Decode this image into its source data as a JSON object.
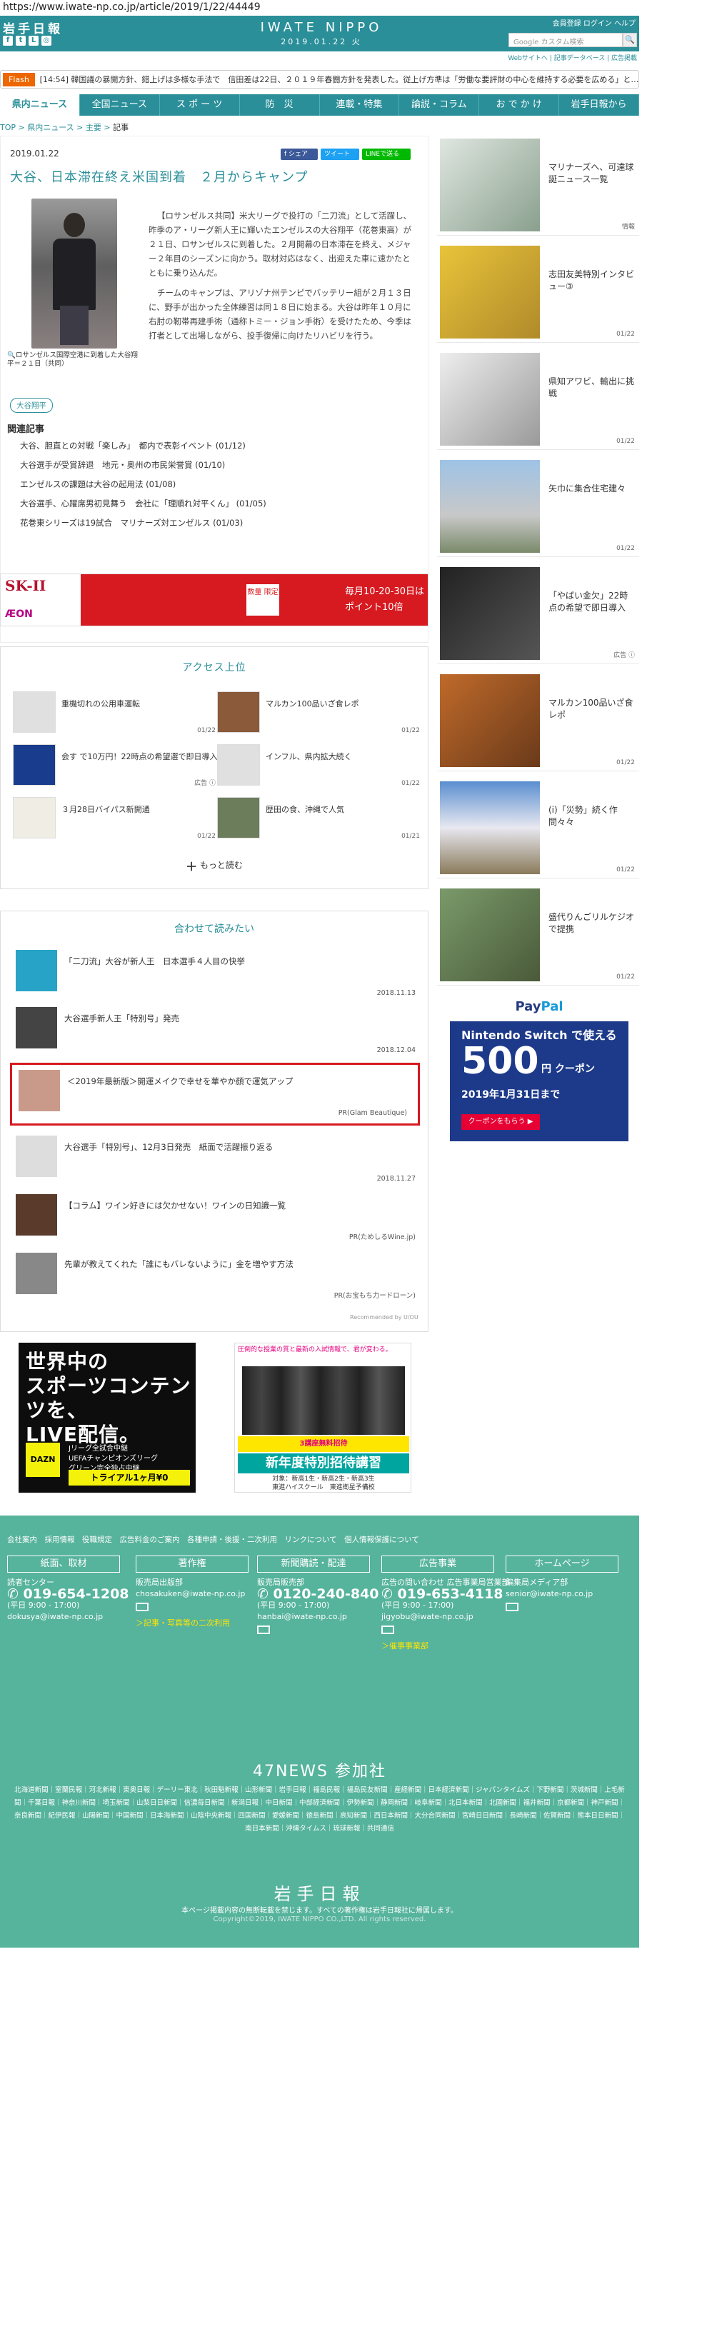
{
  "url": "https://www.iwate-np.co.jp/article/2019/1/22/44449",
  "header": {
    "logo_small": "岩手日報",
    "brand": "IWATE NIPPO",
    "date": "2019.01.22 火",
    "top_links": "会員登録  ログイン  ヘルプ",
    "search_placeholder": "Google カスタム検索",
    "search_button": "🔍",
    "sublinks": "Webサイトへ  |  記事データベース  |  広告掲載"
  },
  "ticker": {
    "badge": "Flash",
    "text": "[14:54] 韓国議の暴開方針、錯上げは多様な手法で　信田差は22日、２０１９年春闘方針を発表した。従上げ方準は「労働な要評財の中心を維持する必要を広める」と…"
  },
  "nav": [
    "県内ニュース",
    "全国ニュース",
    "ス ポ ー ツ",
    "防　災",
    "連載・特集",
    "論説・コラム",
    "お で か け",
    "岩手日報から"
  ],
  "breadcrumb": {
    "top": "TOP",
    "sep1": " > ",
    "l1": "県内ニュース",
    "sep2": " > ",
    "l2": "主要",
    "sep3": " > ",
    "current": "記事"
  },
  "article": {
    "date": "2019.01.22",
    "share_fb": "f シェア",
    "share_tw": "ツイート",
    "share_line": "LINEで送る",
    "title": "大谷、日本滞在終え米国到着　２月からキャンプ",
    "caption": "ロサンゼルス国際空港に到着した大谷翔平＝２１日（共同）",
    "paragraphs": [
      "【ロサンゼルス共同】米大リーグで投打の「二刀流」として活躍し、昨季のア・リーグ新人王に輝いたエンゼルスの大谷翔平（花巻東高）が２１日、ロサンゼルスに到着した。２月開幕の日本滞在を終え、メジャー２年目のシーズンに向かう。取材対応はなく、出迎えた車に速かたとともに乗り込んだ。",
      "チームのキャンプは、アリゾナ州テンピでバッテリー組が２月１３日に、野手が出かった全体練習は同１８日に始まる。大谷は昨年１０月に右肘の靭帯再建手術（通称トミー・ジョン手術）を受けたため、今季は打者として出場しながら、投手復帰に向けたリハビリを行う。"
    ],
    "tag": "大谷翔平",
    "related_heading": "関連記事",
    "related": [
      "大谷、胆直との対戦「楽しみ」　都内で表彰イベント (01/12)",
      "大谷選手が受賞辞退　地元・奥州の市民栄誉賞 (01/10)",
      "エンゼルスの課題は大谷の起用法 (01/08)",
      "大谷選手、心躍席男初見舞う　会社に「理順れ対平くん」 (01/05)",
      "花巻東シリーズは19試合　マリナーズ対エンゼルス (01/03)"
    ]
  },
  "ad_banner": {
    "brand1": "SK-II",
    "brand2": "ÆON",
    "box": "数量 限定",
    "text1": "毎月10-20-30日は",
    "text2": "ポイント10倍"
  },
  "ranking": {
    "title": "アクセス上位",
    "items": [
      {
        "text": "重機切れの公用車運転",
        "date": "01/22"
      },
      {
        "text": "マルカン100品いざ食レポ",
        "date": "01/22"
      },
      {
        "text": "会す で10万円！22時点の希望選で即日導入",
        "date": "広告 ⓘ"
      },
      {
        "text": "インフル、県内拡大続く",
        "date": "01/22"
      },
      {
        "text": "３月28日バイパス新開通",
        "date": "01/22"
      },
      {
        "text": "歴田の食、沖縄で人気",
        "date": "01/21"
      }
    ],
    "more": "もっと読む"
  },
  "also": {
    "title": "合わせて読みたい",
    "items": [
      {
        "text": "「二刀流」大谷が新人王　日本選手４人目の快挙",
        "meta": "2018.11.13"
      },
      {
        "text": "大谷選手新人王「特別号」発売",
        "meta": "2018.12.04"
      },
      {
        "text": "＜2019年最新版＞開運メイクで幸せを華やか顔で運気アップ",
        "meta": "PR(Glam Beautique)"
      },
      {
        "text": "大谷選手「特別号」、12月3日発売　紙面で活躍振り返る",
        "meta": "2018.11.27"
      },
      {
        "text": "【コラム】ワイン好きには欠かせない！ワインの日知識一覧",
        "meta": "PR(ためしるWine.jp)"
      },
      {
        "text": "先輩が教えてくれた「誰にもバレないように」金を増やす方法",
        "meta": "PR(お宝もち力ードローン)"
      }
    ],
    "recommended": "Recommended by U/OU"
  },
  "ad_dazn": {
    "headline": "世界中の\nスポーツコンテンツを、\nLIVE配信。",
    "logo": "DAZN",
    "sub": "Jリーグ全試合中継\nUEFAチャンピオンズリーグ\nグリーン完全独占中継",
    "btn": "トライアル1ヶ月¥0"
  },
  "ad_school": {
    "top": "圧倒的な授業の質と最新の入試情報で、君が変わる。",
    "mid": "3講座無料招待",
    "big": "新年度特別招待講習",
    "bot": "対象：新高1生・新高2生・新高3生\n東進ハイスクール　東進衛星予備校"
  },
  "sidebar": [
    {
      "text": "マリナーズへ、可達球誕ニュース一覧",
      "date": "情報"
    },
    {
      "text": "志田友美特別インタビュー③",
      "date": "01/22"
    },
    {
      "text": "県知アワビ、輸出に挑戦",
      "date": "01/22"
    },
    {
      "text": "矢巾に集合住宅建々",
      "date": "01/22"
    },
    {
      "text": "「やばい金欠」22時点の希望で即日導入",
      "date": "広告 ⓘ"
    },
    {
      "text": "マルカン100品いざ食レポ",
      "date": "01/22"
    },
    {
      "text": "(i)「災勢」続く作問々々",
      "date": "01/22"
    },
    {
      "text": "盛代りんごリルケジオで提携",
      "date": "01/22"
    }
  ],
  "ad_paypal": {
    "logo_a": "Pay",
    "logo_b": "Pal",
    "line1": "Nintendo Switch で使える",
    "num": "500",
    "yen": "円 クーポン",
    "date": "2019年1月31日まで",
    "btn": "クーポンをもらう ▶"
  },
  "footer": {
    "links": "会社案内　採用情報　役職規定　広告料金のご案内　各種申請・後援・二次利用　リンクについて　個人情報保護について",
    "cols": [
      {
        "head": "紙面、取材",
        "l1": "読者センター",
        "tel": "019-654-1208",
        "hours": "(平日 9:00 - 17:00)",
        "mail": "dokusya@iwate-np.co.jp",
        "link": ""
      },
      {
        "head": "著作権",
        "l1": "販売局出版部",
        "tel": "",
        "hours": "",
        "mail": "chosakuken@iwate-np.co.jp",
        "link": "＞記事・写真等の二次利用"
      },
      {
        "head": "新聞購読・配達",
        "l1": "販売局販売部",
        "tel": "0120-240-840",
        "hours": "(平日 9:00 - 17:00)",
        "mail": "hanbai@iwate-np.co.jp",
        "link": ""
      },
      {
        "head": "広告事業",
        "l1": "広告の問い合わせ 広告事業局営業部",
        "tel": "019-653-4118",
        "hours": "(平日 9:00 - 17:00)",
        "mail": "jigyobu@iwate-np.co.jp",
        "link": "＞催事事業部"
      },
      {
        "head": "ホームページ",
        "l1": "編集局メディア部",
        "tel": "",
        "hours": "",
        "mail": "senior@iwate-np.co.jp",
        "link": ""
      }
    ],
    "n47": "47NEWS 参加社",
    "papers": "北海道新聞｜室蘭民報｜河北新報｜東奥日報｜デーリー東北｜秋田魁新報｜山形新聞｜岩手日報｜福島民報｜福島民友新聞｜産経新聞｜日本経済新聞｜ジャパンタイムズ｜下野新聞｜茨城新聞｜上毛新聞｜千葉日報｜神奈川新聞｜埼玉新聞｜山梨日日新聞｜信濃毎日新聞｜新潟日報｜中日新聞｜中部経済新聞｜伊勢新聞｜静岡新聞｜岐阜新聞｜北日本新聞｜北國新聞｜福井新聞｜京都新聞｜神戸新聞｜奈良新聞｜紀伊民報｜山陽新聞｜中国新聞｜日本海新聞｜山陰中央新報｜四国新聞｜愛媛新聞｜徳島新聞｜高知新聞｜西日本新聞｜大分合同新聞｜宮崎日日新聞｜長崎新聞｜佐賀新聞｜熊本日日新聞｜南日本新聞｜沖縄タイムス｜琉球新報｜共同通信",
    "logo": "岩手日報",
    "notice": "本ページ掲載内容の無断転載を禁じます。すべての著作権は岩手日報社に帰属します。",
    "copyright": "Copyright©2019, IWATE NIPPO CO.,LTD. All rights reserved."
  }
}
